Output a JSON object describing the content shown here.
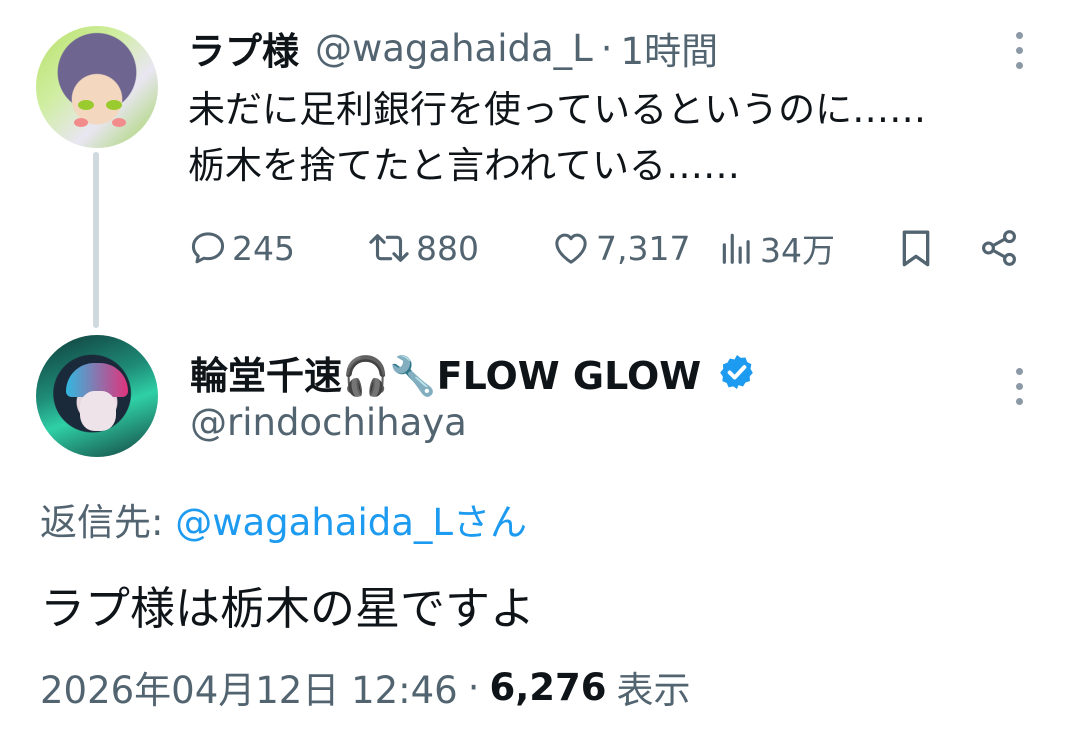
{
  "parent_tweet": {
    "author_name": "ラプ様",
    "author_handle": "@wagahaida_L",
    "separator": "·",
    "time_ago": "1時間",
    "text_lines": [
      "未だに足利銀行を使っているというのに……",
      "栃木を捨てたと言われている……"
    ],
    "stats": {
      "replies": "245",
      "retweets": "880",
      "likes": "7,317",
      "views": "34万"
    },
    "icons": {
      "more": "more-vertical-icon",
      "reply": "reply-bubble-icon",
      "retweet": "retweet-icon",
      "like": "heart-icon",
      "views": "bar-chart-icon",
      "bookmark": "bookmark-icon",
      "share": "share-icon"
    }
  },
  "reply_tweet": {
    "author_name": "輪堂千速🎧🔧FLOW GLOW",
    "author_handle": "@rindochihaya",
    "verified": true,
    "reply_to_prefix": "返信先:",
    "reply_to_mention": "@wagahaida_Lさん",
    "text": "ラプ様は栃木の星ですよ",
    "timestamp": "2026年04月12日 12:46",
    "separator": "·",
    "views_count": "6,276",
    "views_label": "表示"
  },
  "colors": {
    "text_primary": "#0f1419",
    "text_secondary": "#536471",
    "link": "#1d9bf0",
    "thread_line": "#cfd9de",
    "verified_badge": "#1d9bf0"
  }
}
